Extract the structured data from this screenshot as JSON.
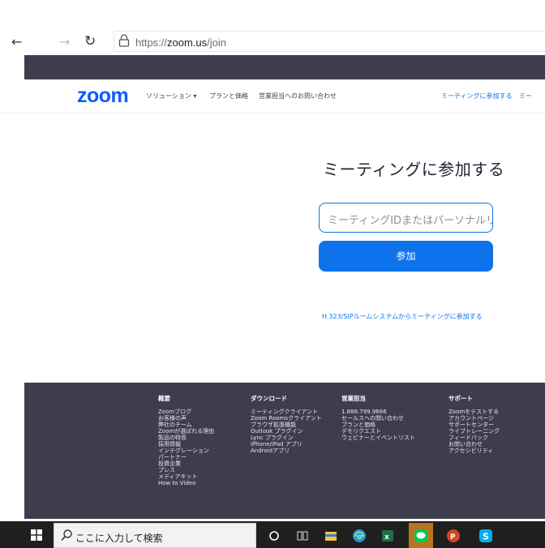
{
  "browser": {
    "back_icon": "←",
    "forward_icon": "→",
    "refresh_icon": "↻",
    "url_prefix": "https://",
    "url_host": "zoom.us",
    "url_path": "/join"
  },
  "header": {
    "logo": "zoom",
    "nav": [
      "ソリューション ▾",
      "プランと価格",
      "営業担当へのお問い合わせ"
    ],
    "right_links": [
      "ミーティングに参加する",
      "ミー"
    ]
  },
  "join": {
    "title": "ミーティングに参加する",
    "input_placeholder": "ミーティングIDまたはパーソナルリ",
    "button_label": "参加",
    "h323_link": "H.323/SIPルームシステムからミーティングに参加する"
  },
  "footer": {
    "columns": [
      {
        "heading": "概要",
        "items": [
          "Zoomブログ",
          "お客様の声",
          "弊社のチーム",
          "Zoomが選ばれる理由",
          "製品の特長",
          "採用情報",
          "インテグレーション",
          "パートナー",
          "投資企業",
          "プレス",
          "メディアキット",
          "How to Video"
        ]
      },
      {
        "heading": "ダウンロード",
        "items": [
          "ミーティングクライアント",
          "Zoom Roomsクライアント",
          "ブラウザ拡張機能",
          "Outlook プラグイン",
          "Lync プラグイン",
          "iPhone/iPad アプリ",
          "Androidアプリ"
        ]
      },
      {
        "heading": "営業担当",
        "items": [
          "1.888.799.9666",
          "セールスへの問い合わせ",
          "プランと価格",
          "デモリクエスト",
          "ウェビナーとイベントリスト"
        ]
      },
      {
        "heading": "サポート",
        "items": [
          "Zoomをテストする",
          "アカウントページ",
          "サポートセンター",
          "ライブトレーニング",
          "フィードバック",
          "お問い合わせ",
          "アクセシビリティ"
        ]
      }
    ]
  },
  "taskbar": {
    "search_placeholder": "ここに入力して検索",
    "icons": [
      "cortana-icon",
      "task-view-icon",
      "file-explorer-icon",
      "edge-icon",
      "excel-icon",
      "line-icon",
      "powerpoint-icon",
      "skype-icon"
    ],
    "colors": {
      "taskbar": "#1f1f1f",
      "active": "#b8741f",
      "explorer": "#f6c244",
      "edge": "#2a8fd6",
      "excel": "#1e7145",
      "line": "#06c755",
      "powerpoint": "#d24726",
      "skype": "#00aff0"
    }
  },
  "colors": {
    "zoom_blue": "#0e72ed",
    "footer_bg": "#3d3d4e"
  }
}
